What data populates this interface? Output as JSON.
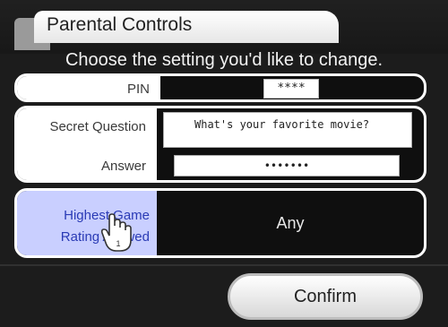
{
  "window": {
    "title": "Parental Controls"
  },
  "instructions": "Choose the setting you'd like to change.",
  "pin": {
    "label": "PIN",
    "value": "****"
  },
  "secret": {
    "question_label": "Secret Question",
    "question_value": "What's your favorite movie?",
    "answer_label": "Answer",
    "answer_value": "•••••••"
  },
  "rating": {
    "label_line1": "Highest Game",
    "label_line2": "Rating Allowed",
    "value": "Any"
  },
  "confirm": {
    "label": "Confirm"
  },
  "colors": {
    "selected_bg": "#c9cfff",
    "selected_text": "#2a3bb5"
  }
}
